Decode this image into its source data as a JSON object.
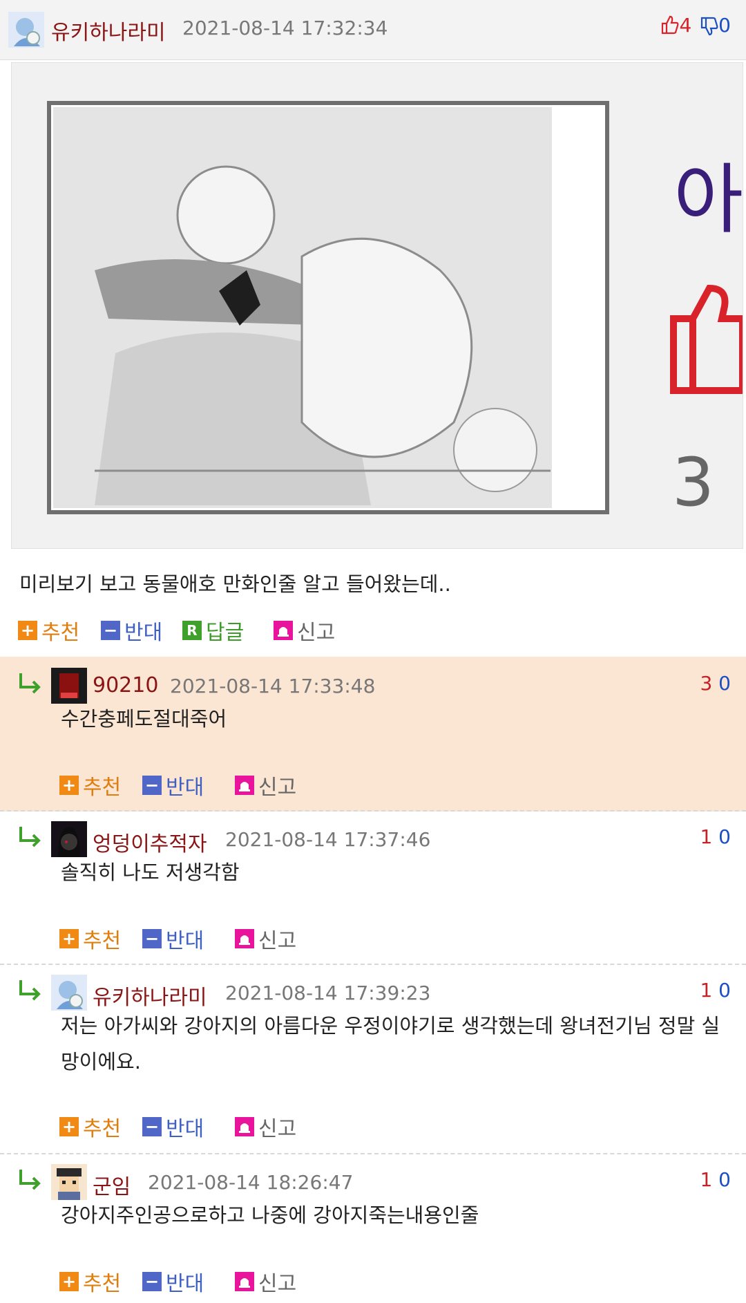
{
  "post": {
    "author": "유키하나라미",
    "datetime": "2021-08-14 17:32:34",
    "upvotes": "4",
    "downvotes": "0",
    "thumbnail_text": {
      "char1": "아",
      "char2": "3"
    },
    "body": "미리보기 보고 동물애호 만화인줄 알고 들어왔는데..",
    "actions": {
      "recommend": "추천",
      "oppose": "반대",
      "reply": "답글",
      "report": "신고"
    }
  },
  "comments": [
    {
      "author": "90210",
      "datetime": "2021-08-14 17:33:48",
      "up": "3",
      "down": "0",
      "text": "수간충페도절대죽어"
    },
    {
      "author": "엉덩이추적자",
      "datetime": "2021-08-14 17:37:46",
      "up": "1",
      "down": "0",
      "text": "솔직히 나도 저생각함"
    },
    {
      "author": "유키하나라미",
      "datetime": "2021-08-14 17:39:23",
      "up": "1",
      "down": "0",
      "text": "저는 아가씨와 강아지의 아름다운 우정이야기로 생각했는데 왕녀전기님 정말 실망이에요."
    },
    {
      "author": "군임",
      "datetime": "2021-08-14 18:26:47",
      "up": "1",
      "down": "0",
      "text": "강아지주인공으로하고 나중에 강아지죽는내용인줄"
    }
  ],
  "comment_actions": {
    "recommend": "추천",
    "oppose": "반대",
    "report": "신고"
  },
  "colors": {
    "nick": "#8b1515",
    "recommend": "#f08a14",
    "oppose": "#5067c8",
    "reply": "#3fa02b",
    "report": "#e8149c",
    "highlight_bg": "#fbe5d3"
  }
}
